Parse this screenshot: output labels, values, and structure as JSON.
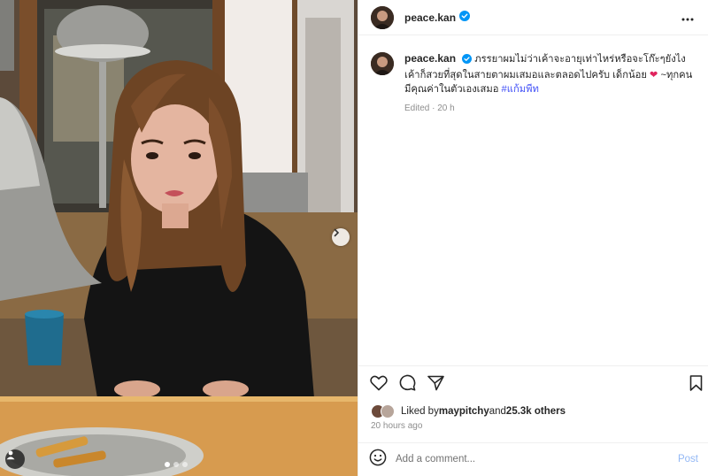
{
  "post": {
    "username": "peace.kan",
    "caption": "ภรรยาผมไม่ว่าเค้าจะอายุเท่าไหร่หรือจะโก๊ะๆยังไง เค้าก็สวยที่สุดในสายตาผมเสมอและตลอดไปครับ เด็กน้อย",
    "heart_emoji": "❤",
    "caption_suffix": " ~ทุกคนมีคุณค่าในตัวเองเสมอ ",
    "hashtag": "#แก้มพีท",
    "edited": "Edited · 20 h",
    "liked_by_prefix": "Liked by ",
    "liked_by_user": "maypitchy",
    "liked_by_join": " and ",
    "liked_by_count": "25.3k others",
    "time_ago": "20 hours ago"
  },
  "comment": {
    "placeholder": "Add a comment...",
    "post_label": "Post"
  },
  "icons": {
    "verified": "verified-badge-icon",
    "more": "more-options-icon",
    "like": "heart-outline-icon",
    "comment": "comment-bubble-icon",
    "share": "paper-plane-icon",
    "save": "bookmark-icon",
    "emoji": "smiley-icon",
    "next": "chevron-right-icon",
    "tag": "user-tag-icon"
  },
  "colors": {
    "verified": "#0095f6",
    "hashtag": "#4150f7",
    "post_button": "#93b8f5",
    "heart": "#e0245e"
  },
  "carousel": {
    "total": 3,
    "current": 1
  }
}
